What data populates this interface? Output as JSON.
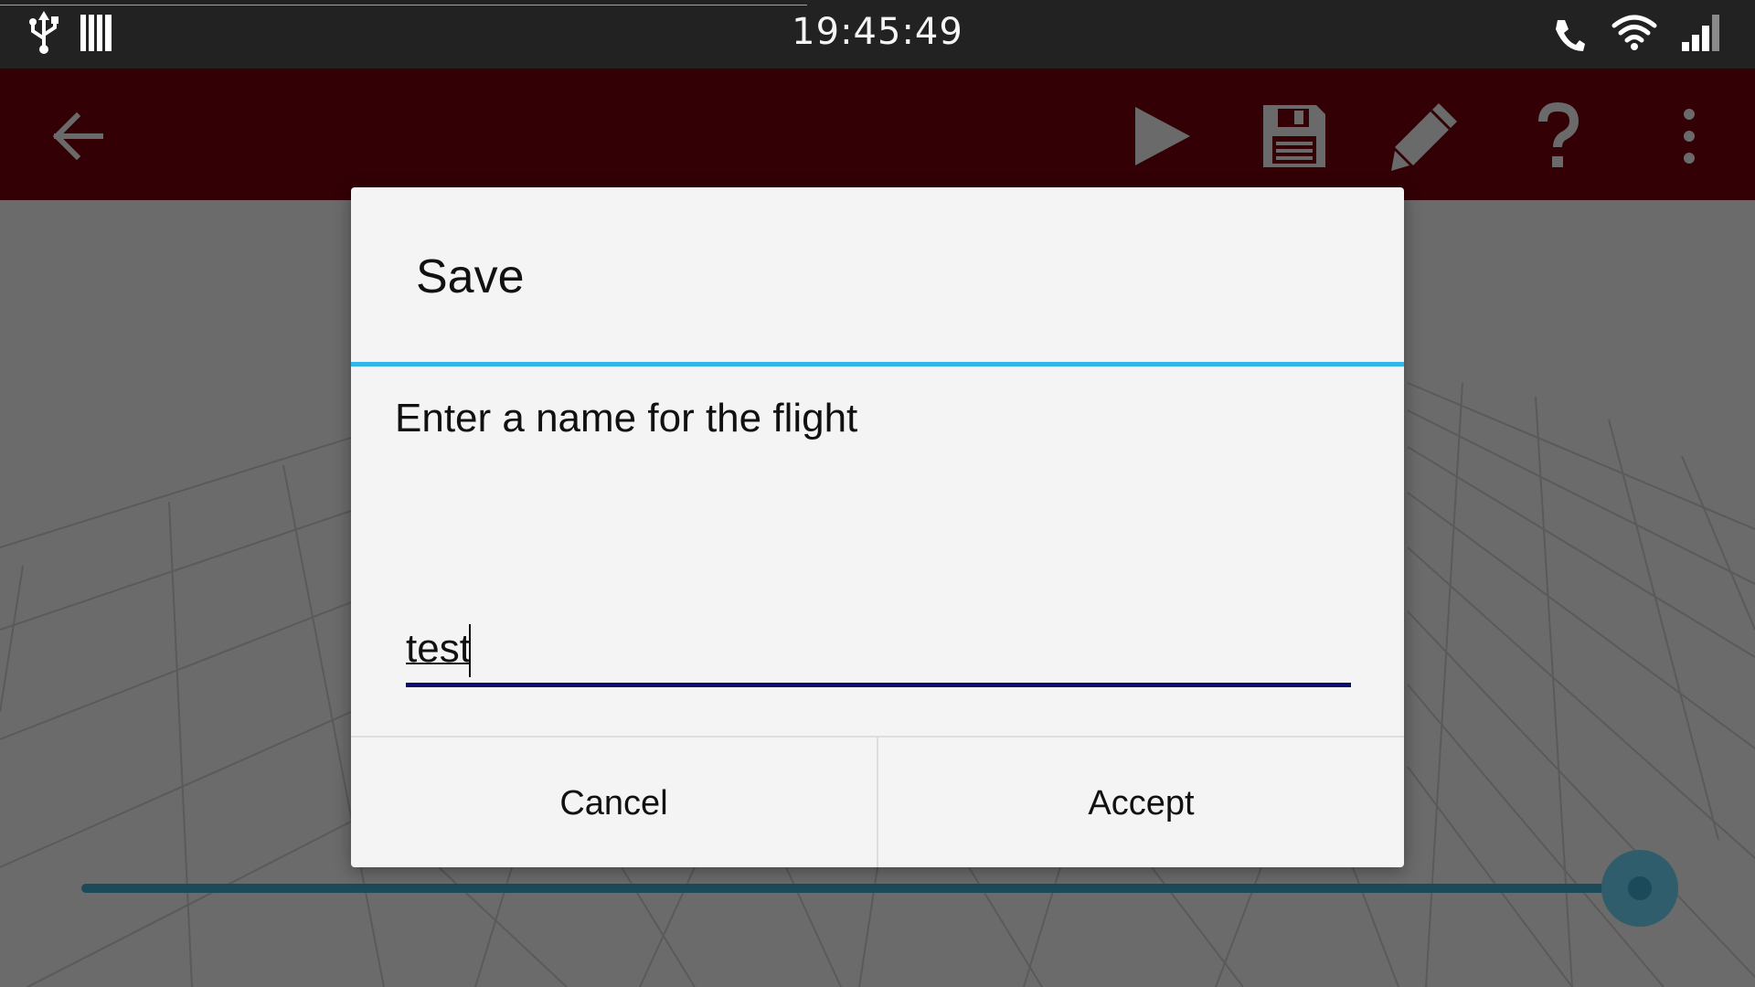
{
  "status_bar": {
    "time": "19:45:49",
    "icons": [
      "usb-icon",
      "sd-card-icon",
      "phone-call-icon",
      "wifi-icon",
      "signal-icon"
    ]
  },
  "action_bar": {
    "background": "#320005",
    "icons": [
      "back-arrow-icon",
      "play-icon",
      "save-icon",
      "pencil-icon",
      "help-icon",
      "overflow-menu-icon"
    ]
  },
  "dialog": {
    "title": "Save",
    "message": "Enter a name for the flight",
    "input_value": "test",
    "accent_color": "#33b5e5",
    "underline_color": "#0c0c70",
    "buttons": {
      "cancel": "Cancel",
      "accept": "Accept"
    }
  },
  "playback": {
    "progress": 0.98,
    "track_color": "#1b4a5a"
  }
}
